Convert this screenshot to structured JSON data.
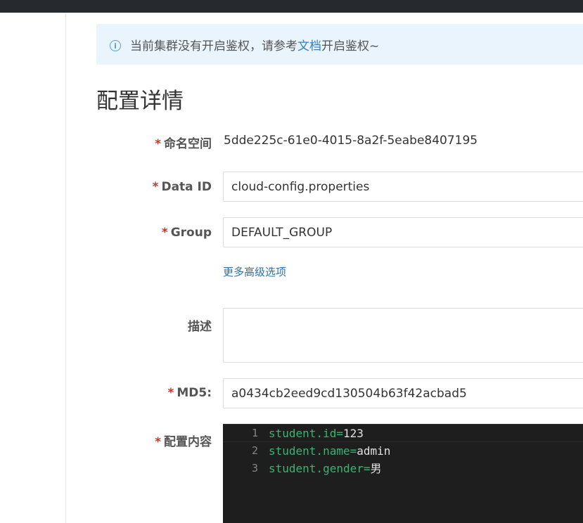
{
  "notice": {
    "text_before": "当前集群没有开启鉴权，请参考",
    "link_text": "文档",
    "text_after": "开启鉴权~"
  },
  "page_title": "配置详情",
  "form": {
    "required_mark": "*",
    "namespace": {
      "label": "命名空间",
      "value": "5dde225c-61e0-4015-8a2f-5eabe8407195"
    },
    "data_id": {
      "label": "Data ID",
      "value": "cloud-config.properties"
    },
    "group": {
      "label": "Group",
      "value": "DEFAULT_GROUP"
    },
    "advanced_link": "更多高级选项",
    "description": {
      "label": "描述",
      "value": ""
    },
    "md5": {
      "label": "MD5:",
      "value": "a0434cb2eed9cd130504b63f42acbad5"
    },
    "content": {
      "label": "配置内容"
    }
  },
  "editor": {
    "lines": [
      {
        "num": "1",
        "key": "student.id",
        "eq": "=",
        "val": "123"
      },
      {
        "num": "2",
        "key": "student.name",
        "eq": "=",
        "val": "admin"
      },
      {
        "num": "3",
        "key": "student.gender",
        "eq": "=",
        "val": "男"
      }
    ]
  },
  "colors": {
    "top_bar": "#262a2f",
    "notice_bg": "#eaf4fd",
    "link": "#2f7fd1",
    "required": "#c0392b",
    "editor_bg": "#1e1e1e",
    "code_key": "#3cb371"
  },
  "icons": {
    "notice": "info-circle-icon"
  }
}
